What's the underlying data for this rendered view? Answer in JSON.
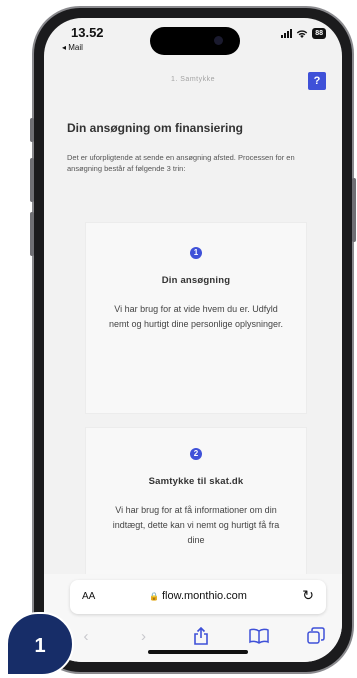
{
  "status_bar": {
    "time": "13.52",
    "back_app": "◂ Mail",
    "battery": "88"
  },
  "header": {
    "step_label": "1. Samtykke",
    "help_label": "?"
  },
  "main": {
    "title": "Din ansøgning om finansiering",
    "intro": "Det er uforpligtende at sende en ansøgning afsted. Processen for en ansøgning består af følgende 3 trin:"
  },
  "cards": [
    {
      "number": "1",
      "title": "Din ansøgning",
      "body": "Vi har brug for at vide hvem du er. Udfyld nemt og hurtigt dine personlige oplysninger."
    },
    {
      "number": "2",
      "title": "Samtykke til skat.dk",
      "body": "Vi har brug for at få informationer om din indtægt, dette kan vi nemt og hurtigt få fra dine"
    }
  ],
  "browser": {
    "aa_label": "AA",
    "url": "flow.monthio.com",
    "lock_icon": "lock-icon"
  },
  "overlay": {
    "step_badge": "1"
  },
  "colors": {
    "accent": "#3f51d8",
    "badge": "#172d68"
  }
}
